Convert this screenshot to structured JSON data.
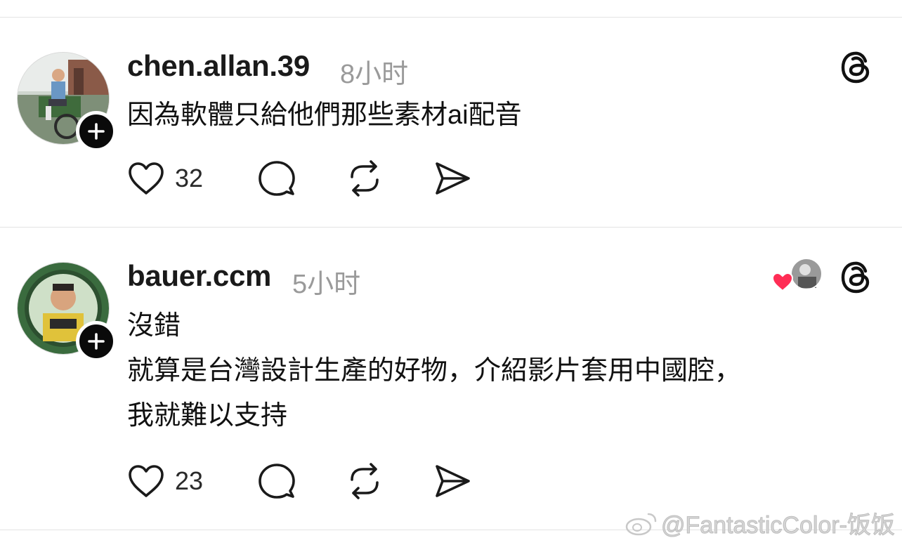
{
  "posts": [
    {
      "username": "chen.allan.39",
      "timestamp": "8小时",
      "lines": [
        "因為軟體只給他們那些素材ai配音"
      ],
      "likes": "32",
      "liked_by_indicator": false
    },
    {
      "username": "bauer.ccm",
      "timestamp": "5小时",
      "lines": [
        "沒錯",
        "就算是台灣設計生產的好物，介紹影片套用中國腔，",
        "我就難以支持"
      ],
      "likes": "23",
      "liked_by_indicator": true
    }
  ],
  "watermark": "@FantasticColor-饭饭",
  "icons": {
    "like": "heart-icon",
    "reply": "comment-bubble-icon",
    "repost": "repost-icon",
    "share": "send-icon",
    "app": "threads-logo-icon",
    "follow": "plus-icon"
  },
  "colors": {
    "liked_heart": "#ff2d55",
    "follow_button": "#0a0a0a",
    "muted_text": "#9a9a9a"
  }
}
